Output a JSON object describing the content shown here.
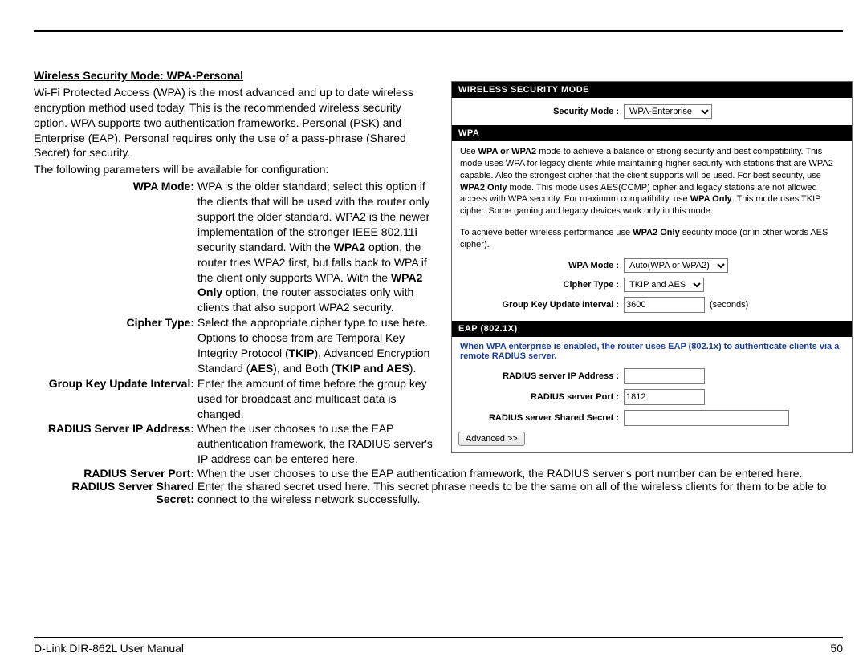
{
  "heading": "Wireless Security Mode: WPA-Personal",
  "intro": "Wi-Fi Protected Access (WPA) is the most advanced and up to date wireless encryption method used today. This is the recommended wireless security option. WPA supports two authentication frameworks. Personal (PSK) and Enterprise (EAP). Personal requires only the use of a pass-phrase (Shared Secret) for security.",
  "params_lead": "The following parameters will be available for configuration:",
  "defs": {
    "wpa_mode_label": "WPA Mode:",
    "wpa_mode_value_a": "WPA is the older standard; select this option if the clients that will be used with the router only support the older standard. WPA2 is the newer implementation of the stronger IEEE 802.11i security standard. With the ",
    "wpa_mode_bold_1": "WPA2",
    "wpa_mode_value_b": " option, the router tries WPA2 first, but falls back to WPA if the client only supports WPA. With the ",
    "wpa_mode_bold_2": "WPA2 Only",
    "wpa_mode_value_c": " option, the router associates only with clients that also support WPA2 security.",
    "cipher_label": "Cipher Type:",
    "cipher_value_a": "Select the appropriate cipher type to use here. Options to choose from are Temporal Key Integrity Protocol (",
    "cipher_bold_1": "TKIP",
    "cipher_value_b": "), Advanced Encryption Standard (",
    "cipher_bold_2": "AES",
    "cipher_value_c": "), and Both (",
    "cipher_bold_3": "TKIP and AES",
    "cipher_value_d": ").",
    "gkui_label": "Group Key Update Interval:",
    "gkui_value": "Enter the amount of time before the group key used for broadcast and multicast data is changed.",
    "radius_ip_label": "RADIUS Server IP Address:",
    "radius_ip_value": "When the user chooses to use the EAP authentication framework, the RADIUS server's IP address can be entered here.",
    "radius_port_label": "RADIUS Server Port:",
    "radius_port_value": "When the user chooses to use the EAP authentication framework, the RADIUS server's port number can be entered here.",
    "radius_secret_label": "RADIUS Server Shared Secret:",
    "radius_secret_value": "Enter the shared secret used here. This secret phrase needs to be the same on all of the wireless clients for them to be able to connect to the wireless network successfully."
  },
  "panel": {
    "bar1": "WIRELESS SECURITY MODE",
    "security_mode_label": "Security Mode  :",
    "security_mode_value": "WPA-Enterprise",
    "bar2": "WPA",
    "note_a": "Use ",
    "note_bold1": "WPA or WPA2",
    "note_b": " mode to achieve a balance of strong security and best compatibility. This mode uses WPA for legacy clients while maintaining higher security with stations that are WPA2 capable. Also the strongest cipher that the client supports will be used. For best security, use ",
    "note_bold2": "WPA2 Only",
    "note_c": " mode. This mode uses AES(CCMP) cipher and legacy stations are not allowed access with WPA security. For maximum compatibility, use ",
    "note_bold3": "WPA Only",
    "note_d": ". This mode uses TKIP cipher. Some gaming and legacy devices work only in this mode.",
    "note2_a": "To achieve better wireless performance use ",
    "note2_bold": "WPA2 Only",
    "note2_b": " security mode (or in other words AES cipher).",
    "wpa_mode_label": "WPA Mode  :",
    "wpa_mode_value": "Auto(WPA or WPA2)",
    "cipher_label": "Cipher Type  :",
    "cipher_value": "TKIP and AES",
    "gkui_label": "Group Key Update Interval  :",
    "gkui_value": "3600",
    "gkui_unit": "(seconds)",
    "bar3": "EAP (802.1X)",
    "eap_note": "When WPA enterprise is enabled, the router uses EAP (802.1x) to authenticate clients via a remote RADIUS server.",
    "radius_ip_label": "RADIUS server IP Address  :",
    "radius_port_label": "RADIUS server Port  :",
    "radius_port_value": "1812",
    "radius_secret_label": "RADIUS server Shared Secret  :",
    "advanced_btn": "Advanced >>"
  },
  "footer_left": "D-Link DIR-862L User Manual",
  "footer_right": "50"
}
